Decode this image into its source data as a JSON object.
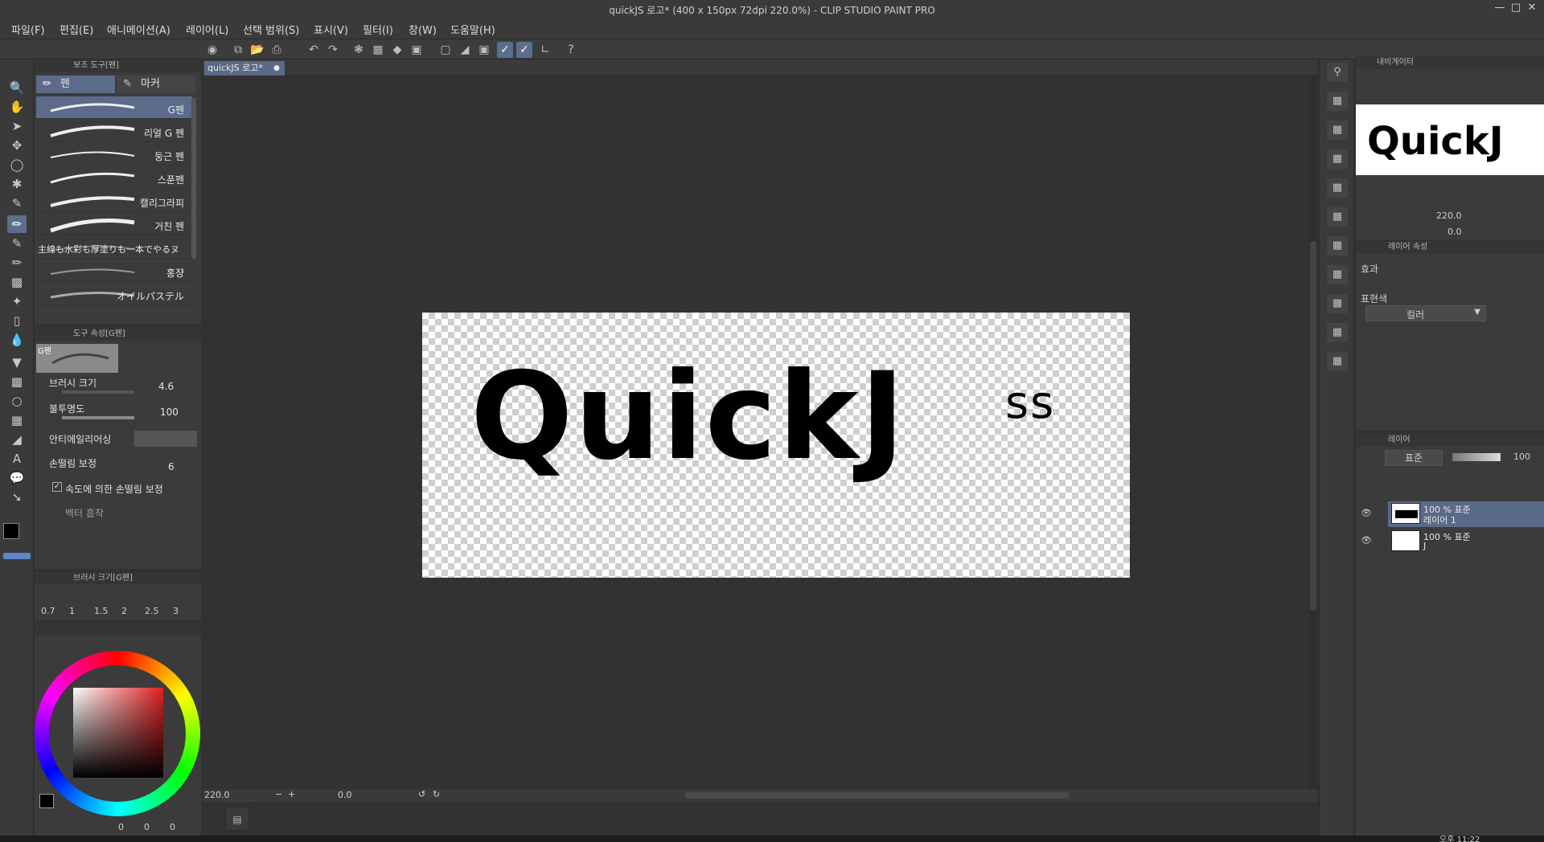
{
  "window": {
    "title": "quickJS 로고* (400 x 150px 72dpi 220.0%)  - CLIP STUDIO PAINT PRO",
    "minimize_icon": "minimize-icon",
    "restore_icon": "restore-icon",
    "close_icon": "close-icon"
  },
  "menu": [
    "파일(F)",
    "편집(E)",
    "애니메이션(A)",
    "레이어(L)",
    "선택 범위(S)",
    "표시(V)",
    "필터(I)",
    "창(W)",
    "도움말(H)"
  ],
  "subtool": {
    "header": "보조 도구[펜]",
    "tabs": [
      "펜",
      "마커"
    ],
    "brushes": [
      "G펜",
      "리얼 G 펜",
      "둥근 펜",
      "스푼펜",
      "캘리그라피",
      "거친 펜",
      "主線も水彩も厚塗りも一本でやるヌ",
      "홍쟝",
      "オイルパステル"
    ],
    "selected": "G펜"
  },
  "toolprop": {
    "header": "도구 속성[G펜]",
    "preview_label": "G펜",
    "brush_size_label": "브러시 크기",
    "brush_size_value": "4.6",
    "opacity_label": "불투명도",
    "opacity_value": "100",
    "antialias_label": "안티에일리어싱",
    "stabilization_label": "손떨림 보정",
    "stabilization_value": "6",
    "speed_stab_label": "속도에 의한 손떨림 보정",
    "vector_label": "벡터 흡착"
  },
  "brushsize_panel": {
    "header": "브러시 크기[G펜]",
    "sizes": [
      "0.7",
      "1",
      "1.5",
      "2",
      "2.5",
      "3"
    ]
  },
  "color": {
    "values": [
      "0",
      "0",
      "0"
    ],
    "main_color": "#000000",
    "sub_color": "#ffffff"
  },
  "document": {
    "tab": "quickJS 로고*",
    "logo_main": "Quick",
    "logo_j": "J",
    "logo_s": "ss",
    "zoom": "220.0",
    "angle": "0.0"
  },
  "navigator": {
    "header": "내비게이터",
    "zoom": "220.0",
    "angle": "0.0",
    "logo": "QuickJ"
  },
  "layerprop": {
    "header": "레이어 속성",
    "effect_label": "효과",
    "expression_label": "표현색",
    "expression_value": "컬러"
  },
  "layers": {
    "header": "레이어",
    "blend_mode": "표준",
    "opacity": "100",
    "rows": [
      {
        "line1": "100 % 표준",
        "line2": "레이어 1",
        "selected": true
      },
      {
        "line1": "100 % 표준",
        "line2": "J",
        "selected": false
      }
    ]
  },
  "taskbar_time": "오후 11:22",
  "accent": "#5a6a88"
}
